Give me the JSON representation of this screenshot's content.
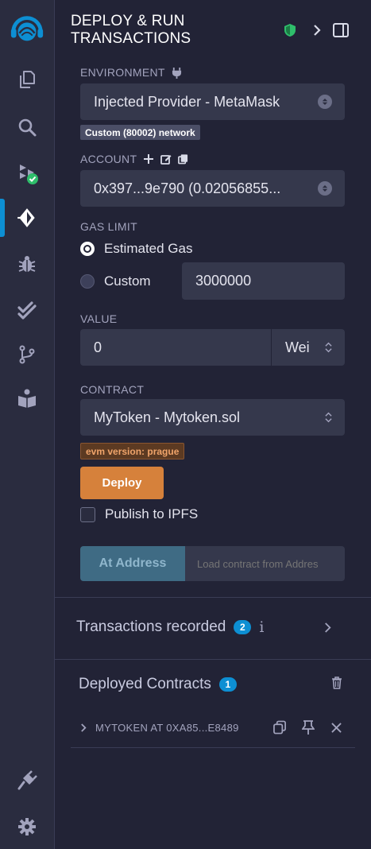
{
  "panel": {
    "title": "DEPLOY & RUN TRANSACTIONS"
  },
  "environment": {
    "label": "ENVIRONMENT",
    "selected": "Injected Provider - MetaMask",
    "network_badge": "Custom (80002) network"
  },
  "account": {
    "label": "ACCOUNT",
    "selected": "0x397...9e790 (0.02056855..."
  },
  "gas": {
    "label": "GAS LIMIT",
    "estimated_label": "Estimated Gas",
    "custom_label": "Custom",
    "custom_value": "3000000",
    "selected": "Estimated Gas"
  },
  "value": {
    "label": "VALUE",
    "amount": "0",
    "unit": "Wei"
  },
  "contract": {
    "label": "CONTRACT",
    "selected": "MyToken - Mytoken.sol",
    "evm_badge": "evm version: prague"
  },
  "actions": {
    "deploy_label": "Deploy",
    "publish_label": "Publish to IPFS",
    "at_address_label": "At Address",
    "at_address_placeholder": "Load contract from Addres"
  },
  "transactions": {
    "title": "Transactions recorded",
    "count": "2",
    "info": "i"
  },
  "deployed": {
    "title": "Deployed Contracts",
    "count": "1",
    "items": [
      {
        "label": "MYTOKEN AT 0XA85...E8489"
      }
    ]
  },
  "colors": {
    "accent_blue": "#0d8fd3",
    "deploy_orange": "#d6813b",
    "shield_green": "#2fbe6b",
    "badge_network_bg": "#4b4e66",
    "badge_evm_bg": "#5c3a22",
    "badge_evm_text": "#f0a46a"
  }
}
